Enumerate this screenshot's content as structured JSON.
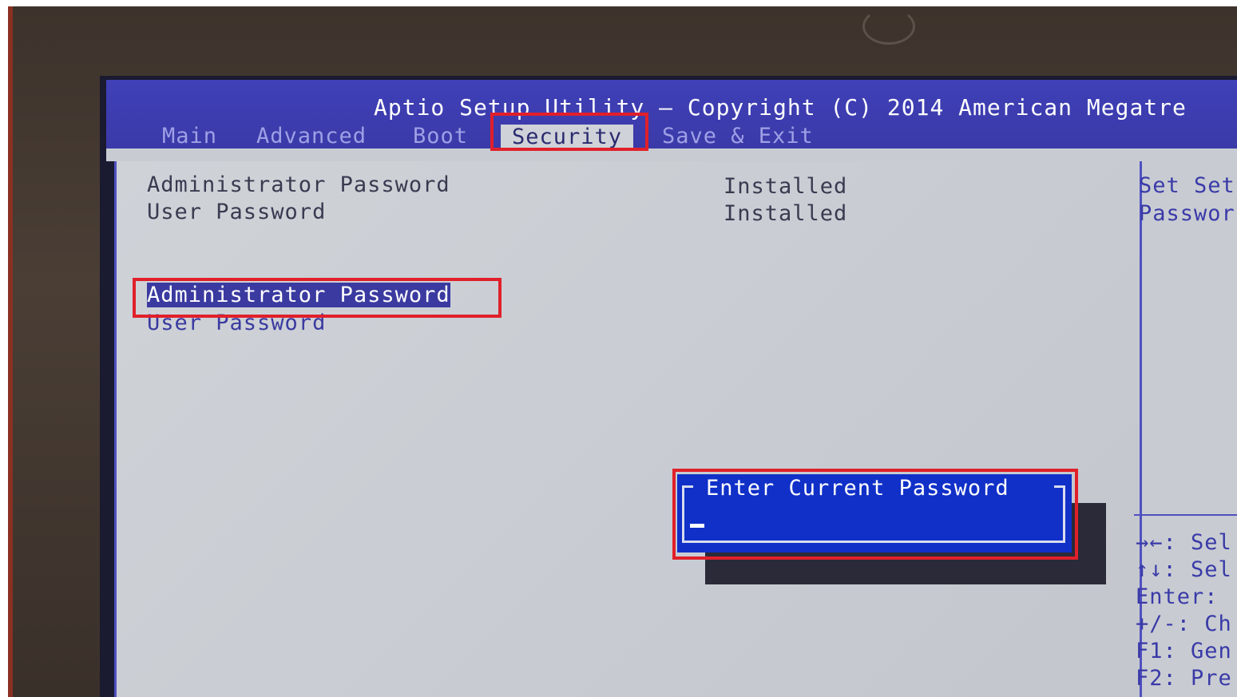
{
  "header": {
    "title": "Aptio Setup Utility – Copyright (C) 2014 American Megatre"
  },
  "tabs": [
    {
      "label": "Main"
    },
    {
      "label": "Advanced"
    },
    {
      "label": "Boot"
    },
    {
      "label": "Security"
    },
    {
      "label": "Save & Exit"
    }
  ],
  "status_rows": [
    {
      "label": "Administrator Password",
      "value": "Installed"
    },
    {
      "label": "User Password",
      "value": "Installed"
    }
  ],
  "menu_items": [
    {
      "label": "Administrator Password"
    },
    {
      "label": "User Password"
    }
  ],
  "help": {
    "line1": "Set Set",
    "line2": "Passwor"
  },
  "keys": [
    "→←: Sel",
    "↑↓: Sel",
    "Enter: ",
    "+/-: Ch",
    "F1: Gen",
    "F2: Pre"
  ],
  "dialog": {
    "title": "Enter Current Password",
    "input_value": ""
  },
  "colors": {
    "header_blue": "#4040b8",
    "panel_gray": "#cfd3d8",
    "dialog_blue": "#1030c8",
    "highlight_red": "#e0202a"
  }
}
